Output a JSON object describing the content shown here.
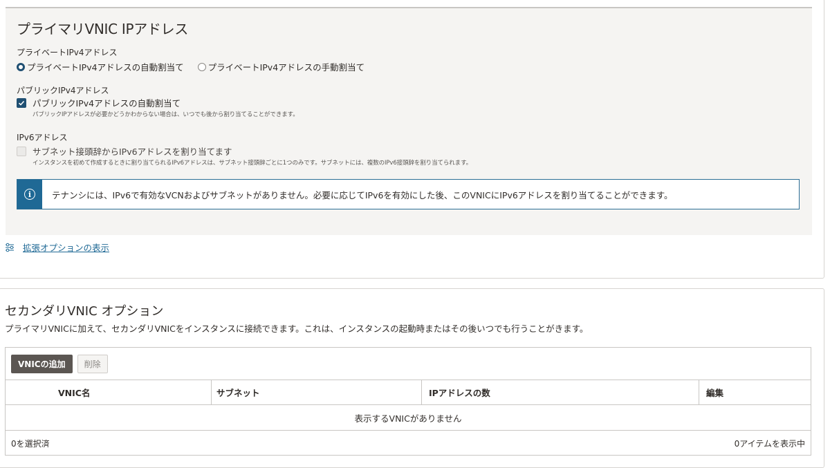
{
  "primary": {
    "title": "プライマリVNIC IPアドレス",
    "private_ipv4": {
      "label": "プライベートIPv4アドレス",
      "options": [
        {
          "label": "プライベートIPv4アドレスの自動割当て",
          "selected": true
        },
        {
          "label": "プライベートIPv4アドレスの手動割当て",
          "selected": false
        }
      ]
    },
    "public_ipv4": {
      "label": "パブリックIPv4アドレス",
      "checkbox_label": "パブリックIPv4アドレスの自動割当て",
      "checked": true,
      "help": "パブリックIPアドレスが必要かどうかわからない場合は、いつでも後から割り当てることができます。"
    },
    "ipv6": {
      "label": "IPv6アドレス",
      "checkbox_label": "サブネット接頭辞からIPv6アドレスを割り当てます",
      "checked": false,
      "disabled": true,
      "help": "インスタンスを初めて作成するときに割り当てられるIPv6アドレスは、サブネット接頭辞ごとに1つのみです。サブネットには、複数のIPv6接頭辞を割り当てられます。"
    },
    "info": "テナンシには、IPv6で有効なVCNおよびサブネットがありません。必要に応じてIPv6を有効にした後、このVNICにIPv6アドレスを割り当てることができます。",
    "advanced_link": "拡張オプションの表示"
  },
  "secondary": {
    "title": "セカンダリVNIC オプション",
    "description": "プライマリVNICに加えて、セカンダリVNICをインスタンスに接続できます。これは、インスタンスの起動時またはその後いつでも行うことがきます。",
    "add_button": "VNICの追加",
    "delete_button": "削除",
    "columns": [
      "VNIC名",
      "サブネット",
      "IPアドレスの数",
      "編集"
    ],
    "empty_message": "表示するVNICがありません",
    "selected_count": "0を選択済",
    "item_count": "0アイテムを表示中"
  },
  "colors": {
    "accent": "#1f4f72",
    "info_blue": "#1f6995",
    "primary_button": "#5b5652"
  }
}
